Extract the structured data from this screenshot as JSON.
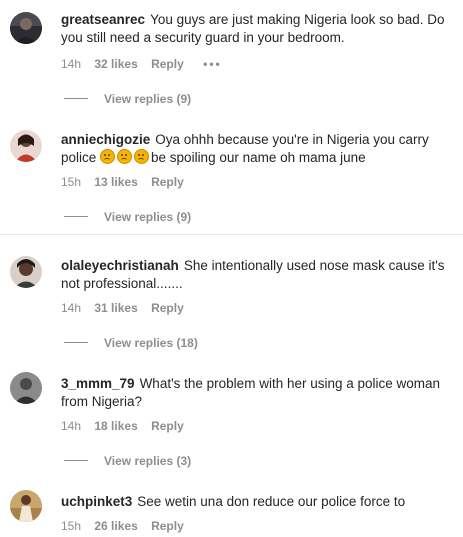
{
  "comments": [
    {
      "username": "greatseanrec",
      "text": "You guys are just making Nigeria look so bad. Do you still need a security guard in your bedroom.",
      "time": "14h",
      "likes": "32 likes",
      "reply": "Reply",
      "more": "•••",
      "view_replies": "View replies (9)"
    },
    {
      "username": "anniechigozie",
      "text_before": "Oya ohhh because you're in Nigeria you carry police ",
      "emojis": [
        "sad-face-emoji",
        "sad-face-emoji",
        "sad-face-emoji"
      ],
      "text_after": "be spoiling our name oh mama june",
      "time": "15h",
      "likes": "13 likes",
      "reply": "Reply",
      "view_replies": "View replies (9)"
    },
    {
      "username": "olaleyechristianah",
      "text": "She intentionally used nose mask cause it's not professional.......",
      "time": "14h",
      "likes": "31 likes",
      "reply": "Reply",
      "view_replies": "View replies (18)"
    },
    {
      "username": "3_mmm_79",
      "text": "What's the problem with her using a police woman from Nigeria?",
      "time": "14h",
      "likes": "18 likes",
      "reply": "Reply",
      "view_replies": "View replies (3)"
    },
    {
      "username": "uchpinket3",
      "text": "See wetin una don reduce our police force to",
      "time": "15h",
      "likes": "26 likes",
      "reply": "Reply"
    }
  ],
  "colors": {
    "text": "#262626",
    "meta": "#8e8e8e",
    "divider": "#e6e6e6"
  }
}
